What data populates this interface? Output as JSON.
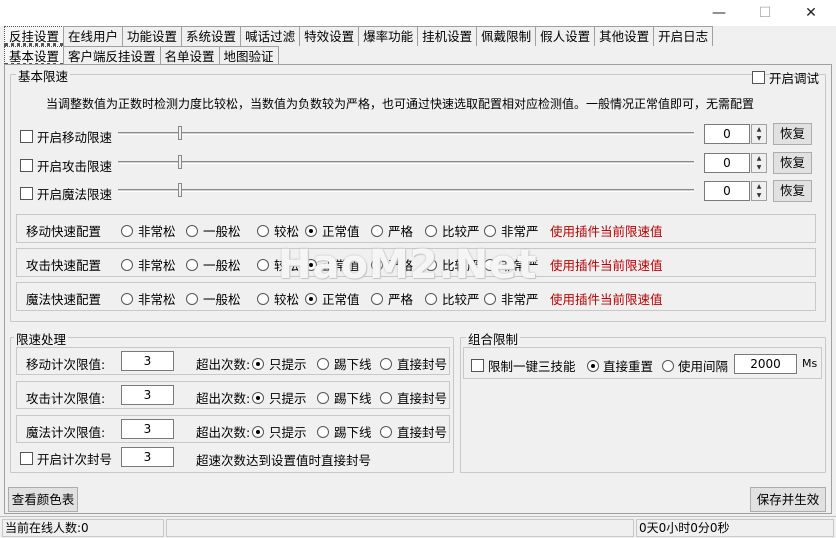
{
  "window": {
    "minimize": "—",
    "maximize": "☐",
    "close": "✕"
  },
  "tabs_row1": [
    "反挂设置",
    "在线用户",
    "功能设置",
    "系统设置",
    "喊话过滤",
    "特效设置",
    "爆率功能",
    "挂机设置",
    "佩戴限制",
    "假人设置",
    "其他设置",
    "开启日志"
  ],
  "tabs_row2": [
    "基本设置",
    "客户端反挂设置",
    "名单设置",
    "地图验证"
  ],
  "basic_speed": {
    "title": "基本限速",
    "debug_label": "开启调试",
    "hint": "当调整数值为正数时检测力度比较松，当数值为负数较为严格，也可通过快速选取配置相对应检测值。一般情况正常值即可，无需配置",
    "sliders": [
      {
        "label": "开启移动限速",
        "value": "0",
        "restore": "恢复"
      },
      {
        "label": "开启攻击限速",
        "value": "0",
        "restore": "恢复"
      },
      {
        "label": "开启魔法限速",
        "value": "0",
        "restore": "恢复"
      }
    ],
    "quick_configs": [
      {
        "label": "移动快速配置",
        "options": [
          "非常松",
          "一般松",
          "较松",
          "正常值",
          "严格",
          "比较严",
          "非常严"
        ],
        "selected": 3,
        "plugin_text": "使用插件当前限速值"
      },
      {
        "label": "攻击快速配置",
        "options": [
          "非常松",
          "一般松",
          "较松",
          "正常值",
          "严格",
          "比较严",
          "非常严"
        ],
        "selected": 3,
        "plugin_text": "使用插件当前限速值"
      },
      {
        "label": "魔法快速配置",
        "options": [
          "非常松",
          "一般松",
          "较松",
          "正常值",
          "严格",
          "比较严",
          "非常严"
        ],
        "selected": 3,
        "plugin_text": "使用插件当前限速值"
      }
    ]
  },
  "speed_handling": {
    "title": "限速处理",
    "exceed_label": "超出次数:",
    "options": [
      "只提示",
      "踢下线",
      "直接封号"
    ],
    "rows": [
      {
        "label": "移动计次限值:",
        "value": "3",
        "selected": 0
      },
      {
        "label": "攻击计次限值:",
        "value": "3",
        "selected": 0
      },
      {
        "label": "魔法计次限值:",
        "value": "3",
        "selected": 0
      }
    ],
    "ban_label": "开启计次封号",
    "ban_value": "3",
    "ban_desc": "超速次数达到设置值时直接封号"
  },
  "combo_limit": {
    "title": "组合限制",
    "checkbox_label": "限制一键三技能",
    "options": [
      "直接重置",
      "使用间隔"
    ],
    "selected": 0,
    "interval_value": "2000",
    "unit": "Ms"
  },
  "buttons": {
    "view_colors": "查看颜色表",
    "save": "保存并生效"
  },
  "status": {
    "online": "当前在线人数:0",
    "middle": "",
    "uptime": "0天0小时0分0秒"
  },
  "watermark": "HaoM2.Net"
}
